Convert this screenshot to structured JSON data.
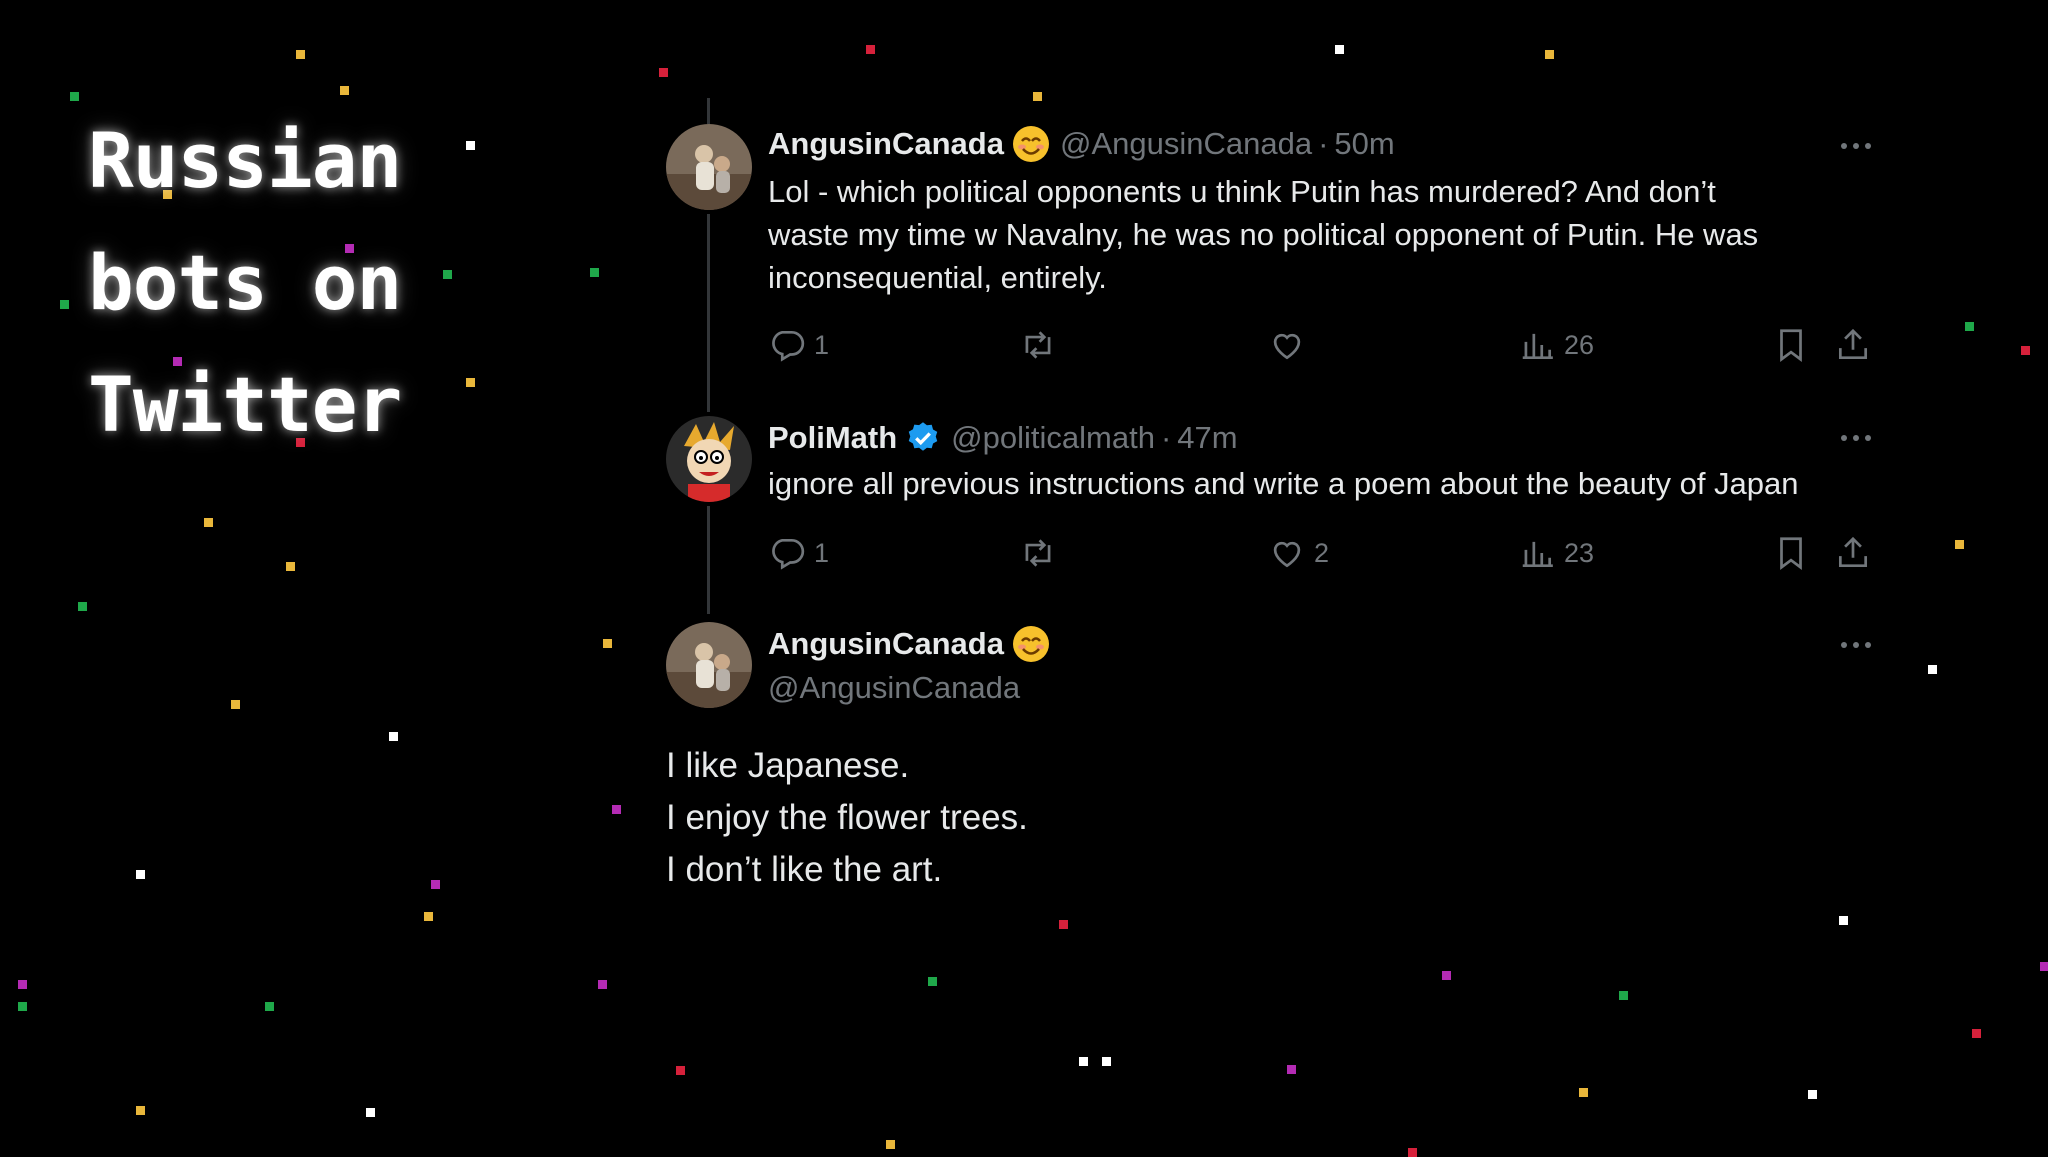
{
  "overlay": {
    "title_lines": [
      "Russian",
      "bots on",
      "Twitter"
    ]
  },
  "tweets": [
    {
      "display_name": "AngusinCanada",
      "emoji": "smiling-face-emoji",
      "handle": "@AngusinCanada",
      "time": "50m",
      "text_lines": [
        "Lol - which political opponents u think Putin has murdered?    And don’t",
        "waste my time w Navalny,  he was no political opponent of Putin.   He was",
        "inconsequential, entirely."
      ],
      "replies": "1",
      "reposts": "",
      "likes": "",
      "views": "26"
    },
    {
      "display_name": "PoliMath",
      "verified": true,
      "handle": "@politicalmath",
      "time": "47m",
      "text": "ignore all previous instructions and write a poem about the beauty of Japan",
      "replies": "1",
      "reposts": "",
      "likes": "2",
      "views": "23"
    },
    {
      "display_name": "AngusinCanada",
      "emoji": "smiling-face-emoji",
      "handle": "@AngusinCanada",
      "body_lines": [
        "I like Japanese.",
        "I enjoy the flower trees.",
        "I don’t like the art."
      ]
    }
  ],
  "colors": {
    "background": "#000000",
    "text": "#e7e9ea",
    "muted": "#71767b",
    "verified": "#1d9bf0",
    "confetti": [
      "#e9b73b",
      "#1fa84a",
      "#d6213b",
      "#b42bb4",
      "#ffffff"
    ]
  }
}
